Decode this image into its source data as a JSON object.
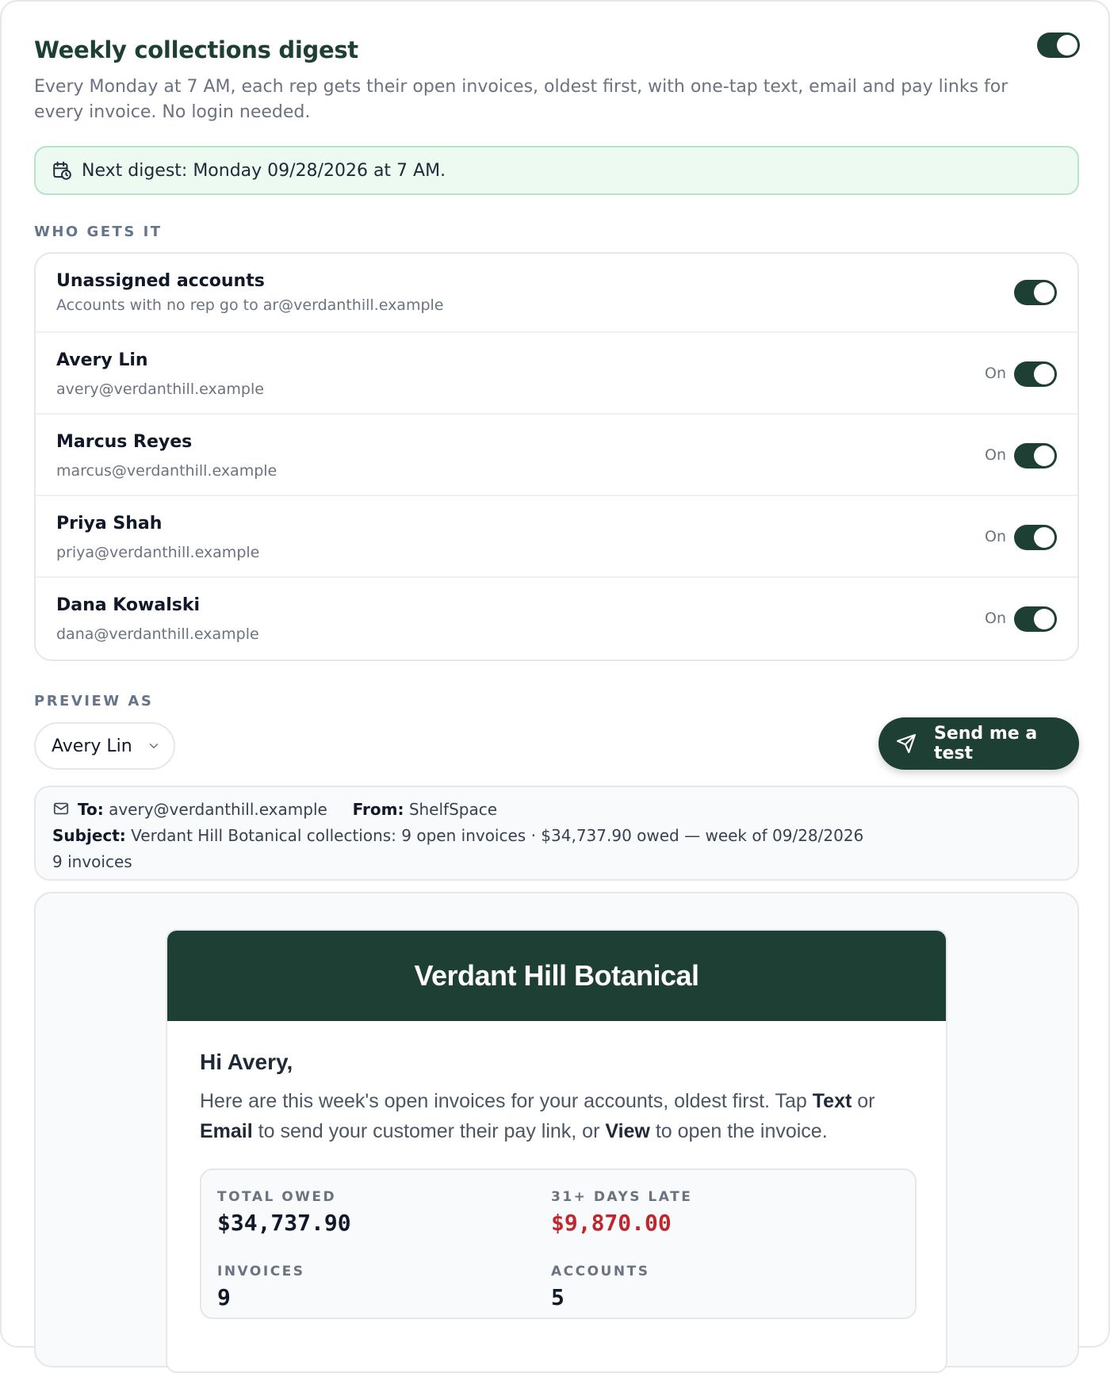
{
  "header": {
    "title": "Weekly collections digest",
    "description": "Every Monday at 7 AM, each rep gets their open invoices, oldest first, with one-tap text, email and pay links for every invoice. No login needed.",
    "enabled": true
  },
  "next_digest": {
    "icon": "calendar-clock-icon",
    "text": "Next digest: Monday 09/28/2026 at 7 AM."
  },
  "who_gets_it": {
    "label": "WHO GETS IT",
    "unassigned": {
      "name": "Unassigned accounts",
      "detail": "Accounts with no rep go to ar@verdanthill.example",
      "enabled": true
    },
    "reps": [
      {
        "name": "Avery Lin",
        "email": "avery@verdanthill.example",
        "status": "On"
      },
      {
        "name": "Marcus Reyes",
        "email": "marcus@verdanthill.example",
        "status": "On"
      },
      {
        "name": "Priya Shah",
        "email": "priya@verdanthill.example",
        "status": "On"
      },
      {
        "name": "Dana Kowalski",
        "email": "dana@verdanthill.example",
        "status": "On"
      }
    ]
  },
  "preview": {
    "label": "PREVIEW AS",
    "selected": "Avery Lin",
    "send_test_label": "Send me a test"
  },
  "email_meta": {
    "to_label": "To:",
    "to": "avery@verdanthill.example",
    "from_label": "From:",
    "from": "ShelfSpace",
    "subject_label": "Subject:",
    "subject": "Verdant Hill Botanical collections: 9 open invoices · $34,737.90 owed — week of 09/28/2026",
    "count": "9 invoices"
  },
  "email": {
    "brand": "Verdant Hill Botanical",
    "greeting": "Hi Avery,",
    "intro_1": "Here are this week's open invoices for your accounts, oldest first. Tap ",
    "intro_text": "Text",
    "intro_2": " or ",
    "intro_email": "Email",
    "intro_3": " to send your customer their pay link, or ",
    "intro_view": "View",
    "intro_4": " to open the invoice.",
    "stats": {
      "total_owed_label": "TOTAL OWED",
      "total_owed": "$34,737.90",
      "late_label": "31+ DAYS LATE",
      "late": "$9,870.00",
      "invoices_label": "INVOICES",
      "invoices": "9",
      "accounts_label": "ACCOUNTS",
      "accounts": "5"
    }
  },
  "colors": {
    "brand_green": "#1e4034",
    "banner_bg": "#ecfaf1",
    "late_red": "#c0262d"
  }
}
